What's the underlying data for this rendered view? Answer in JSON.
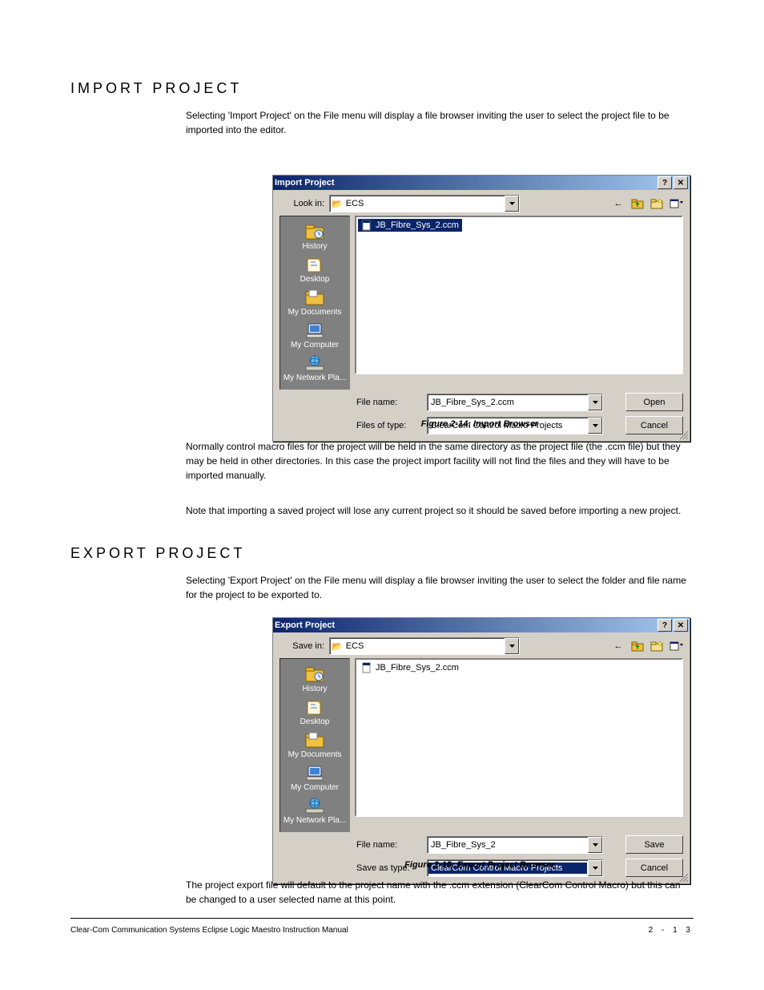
{
  "doc": {
    "heading": "IMPORT PROJECT",
    "p1": "Selecting 'Import Project' on the File menu will display a file browser inviting the user to select the project file to be imported into the editor.",
    "fig1": "Figure 2-14: Import Browser",
    "p2": "Normally control macro files for the project will be held in the same directory as the project file (the .ccm file) but they may be held in other directories. In this case the project import facility will not find the files and they will have to be imported manually.",
    "p3": "Note that importing a saved project will lose any current project so it should be saved before importing a new project.",
    "heading2": "EXPORT PROJECT",
    "p4": "Selecting 'Export Project' on the File menu will display a file browser inviting the user to select the folder and file name for the project to be exported to.",
    "fig2": "Figure 2-15: Export Project Browser",
    "p5": "The project export file will default to the project name with the .ccm extension (ClearCom Control Macro) but this can be changed to a user selected name at this point.",
    "footerL": "Clear-Com Communication Systems\nEclipse Logic Maestro Instruction Manual",
    "footerR": "2 - 1 3"
  },
  "dialog1": {
    "title": "Import Project",
    "lookin_label": "Look in:",
    "lookin_value": "ECS",
    "places": [
      "History",
      "Desktop",
      "My Documents",
      "My Computer",
      "My Network Pla..."
    ],
    "file_listed": "JB_Fibre_Sys_2.ccm",
    "file_selected": true,
    "filename_label": "File name:",
    "filename_value": "JB_Fibre_Sys_2.ccm",
    "filetype_label": "Files of type:",
    "filetype_value": "ClearCom Control Macro Projects",
    "primary_btn": "Open",
    "cancel_btn": "Cancel"
  },
  "dialog2": {
    "title": "Export Project",
    "lookin_label": "Save in:",
    "lookin_value": "ECS",
    "places": [
      "History",
      "Desktop",
      "My Documents",
      "My Computer",
      "My Network Pla..."
    ],
    "file_listed": "JB_Fibre_Sys_2.ccm",
    "file_selected": false,
    "filename_label": "File name:",
    "filename_value": "JB_Fibre_Sys_2",
    "filetype_label": "Save as type:",
    "filetype_value": "ClearCom Control Macro Projects",
    "filetype_highlight": true,
    "primary_btn": "Save",
    "cancel_btn": "Cancel"
  }
}
